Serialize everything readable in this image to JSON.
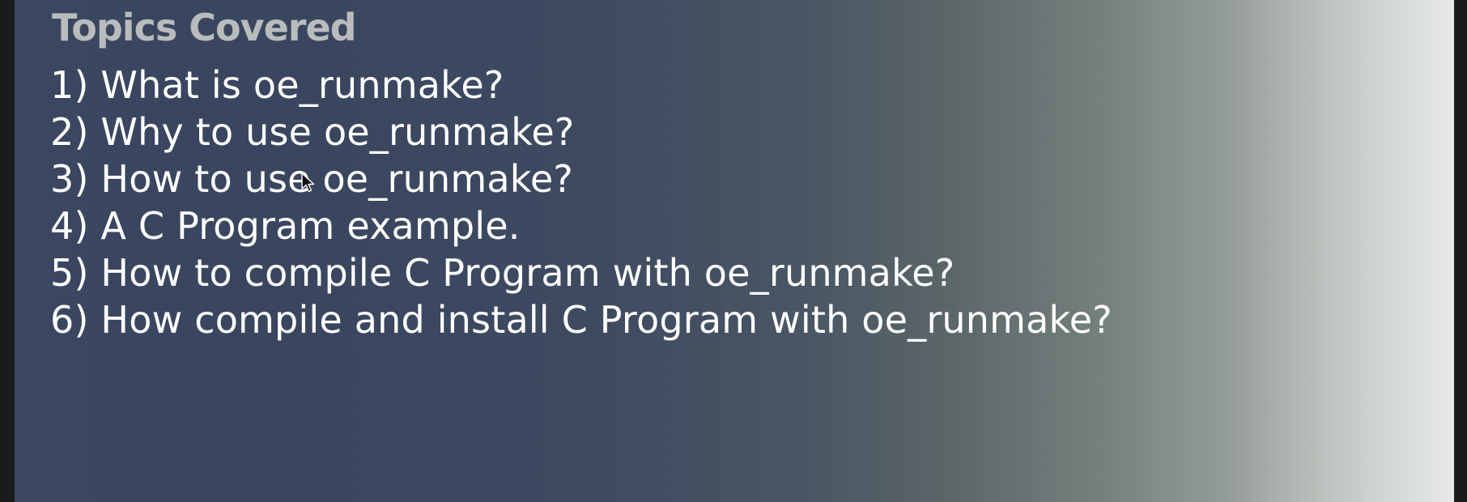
{
  "slide": {
    "title": "Topics Covered",
    "topics": [
      "1) What is oe_runmake?",
      "2) Why to use oe_runmake?",
      "3) How to use oe_runmake?",
      "4) A C Program example.",
      "5) How to compile C Program with oe_runmake?",
      "6) How compile and install C Program with oe_runmake?"
    ]
  },
  "icons": {
    "cursor": "mouse-pointer-icon"
  },
  "colors": {
    "title": "#b9bcbc",
    "text": "#ffffff",
    "gradient_left": "#3b4660",
    "gradient_right": "#e8ebe8",
    "frame": "#1b1b1b"
  }
}
